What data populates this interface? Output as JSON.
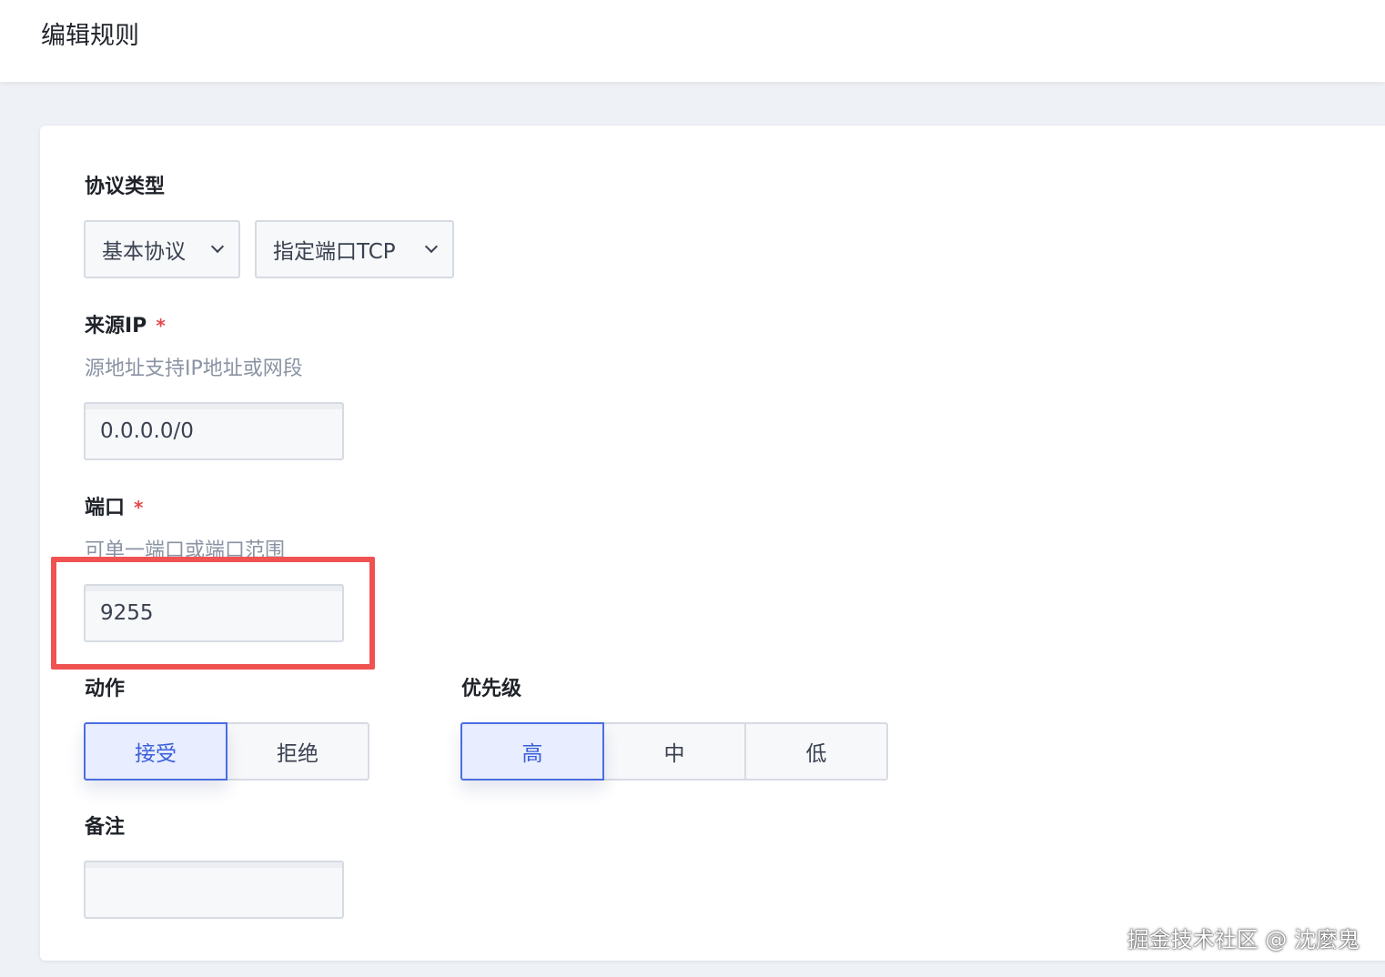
{
  "header": {
    "title": "编辑规则"
  },
  "protocol": {
    "label": "协议类型",
    "basic_select": "基本协议",
    "port_select": "指定端口TCP"
  },
  "source_ip": {
    "label": "来源IP",
    "required_mark": "*",
    "hint": "源地址支持IP地址或网段",
    "value": "0.0.0.0/0"
  },
  "port": {
    "label": "端口",
    "required_mark": "*",
    "hint": "可单一端口或端口范围",
    "value": "9255"
  },
  "action": {
    "label": "动作",
    "options": [
      "接受",
      "拒绝"
    ],
    "selected": "接受"
  },
  "priority": {
    "label": "优先级",
    "options": [
      "高",
      "中",
      "低"
    ],
    "selected": "高"
  },
  "remark": {
    "label": "备注",
    "value": ""
  },
  "watermark": "掘金技术社区 @ 沈麼鬼",
  "colors": {
    "accent": "#4a6ee0",
    "required": "#e5484d",
    "highlight": "#f05252"
  }
}
